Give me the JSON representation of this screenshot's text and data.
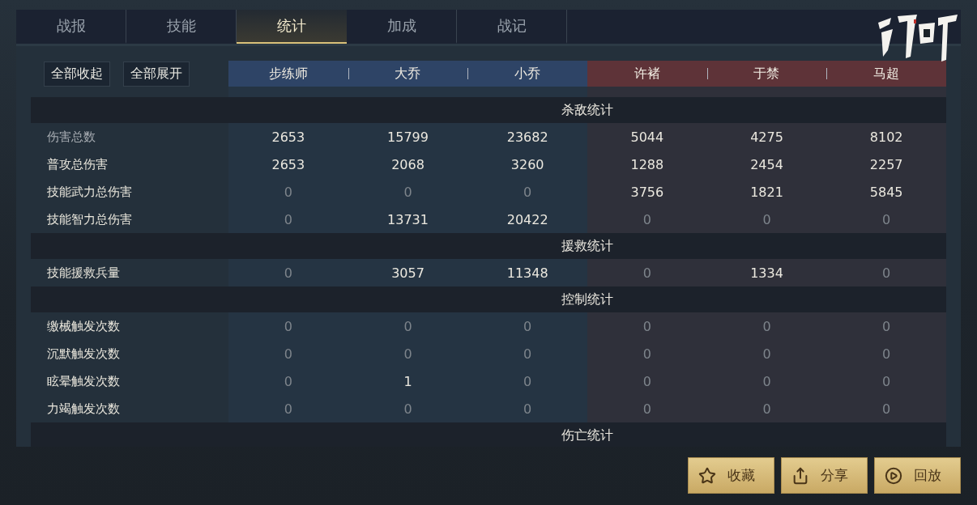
{
  "tabs": [
    {
      "label": "战报",
      "selected": false
    },
    {
      "label": "技能",
      "selected": false
    },
    {
      "label": "统计",
      "selected": true
    },
    {
      "label": "加成",
      "selected": false
    },
    {
      "label": "战记",
      "selected": false
    }
  ],
  "toolbar": {
    "collapse_all": "全部收起",
    "expand_all": "全部展开"
  },
  "heroes": [
    {
      "name": "步练师",
      "color": "#2e4466"
    },
    {
      "name": "大乔",
      "color": "#2e4466"
    },
    {
      "name": "小乔",
      "color": "#2e4466"
    },
    {
      "name": "许褚",
      "color": "#5e3338"
    },
    {
      "name": "于禁",
      "color": "#5e3338"
    },
    {
      "name": "马超",
      "color": "#5e3338"
    }
  ],
  "sections": [
    {
      "title": "杀敌统计",
      "rows": [
        {
          "label": "伤害总数",
          "dim": true,
          "cells": [
            {
              "text": "2653",
              "dim": false
            },
            {
              "text": "15799",
              "dim": false
            },
            {
              "text": "23682",
              "dim": false
            },
            {
              "text": "5044",
              "dim": false
            },
            {
              "text": "4275",
              "dim": false
            },
            {
              "text": "8102",
              "dim": false
            }
          ]
        },
        {
          "label": "普攻总伤害",
          "dim": false,
          "cells": [
            {
              "text": "2653",
              "dim": false
            },
            {
              "text": "2068",
              "dim": false
            },
            {
              "text": "3260",
              "dim": false
            },
            {
              "text": "1288",
              "dim": false
            },
            {
              "text": "2454",
              "dim": false
            },
            {
              "text": "2257",
              "dim": false
            }
          ]
        },
        {
          "label": "技能武力总伤害",
          "dim": false,
          "cells": [
            {
              "text": "0",
              "dim": true
            },
            {
              "text": "0",
              "dim": true
            },
            {
              "text": "0",
              "dim": true
            },
            {
              "text": "3756",
              "dim": false
            },
            {
              "text": "1821",
              "dim": false
            },
            {
              "text": "5845",
              "dim": false
            }
          ]
        },
        {
          "label": "技能智力总伤害",
          "dim": false,
          "cells": [
            {
              "text": "0",
              "dim": true
            },
            {
              "text": "13731",
              "dim": false
            },
            {
              "text": "20422",
              "dim": false
            },
            {
              "text": "0",
              "dim": true
            },
            {
              "text": "0",
              "dim": true
            },
            {
              "text": "0",
              "dim": true
            }
          ]
        }
      ]
    },
    {
      "title": "援救统计",
      "rows": [
        {
          "label": "技能援救兵量",
          "dim": false,
          "cells": [
            {
              "text": "0",
              "dim": true
            },
            {
              "text": "3057",
              "dim": false
            },
            {
              "text": "11348",
              "dim": false
            },
            {
              "text": "0",
              "dim": true
            },
            {
              "text": "1334",
              "dim": false
            },
            {
              "text": "0",
              "dim": true
            }
          ]
        }
      ]
    },
    {
      "title": "控制统计",
      "rows": [
        {
          "label": "缴械触发次数",
          "dim": false,
          "cells": [
            {
              "text": "0",
              "dim": true
            },
            {
              "text": "0",
              "dim": true
            },
            {
              "text": "0",
              "dim": true
            },
            {
              "text": "0",
              "dim": true
            },
            {
              "text": "0",
              "dim": true
            },
            {
              "text": "0",
              "dim": true
            }
          ]
        },
        {
          "label": "沉默触发次数",
          "dim": false,
          "cells": [
            {
              "text": "0",
              "dim": true
            },
            {
              "text": "0",
              "dim": true
            },
            {
              "text": "0",
              "dim": true
            },
            {
              "text": "0",
              "dim": true
            },
            {
              "text": "0",
              "dim": true
            },
            {
              "text": "0",
              "dim": true
            }
          ]
        },
        {
          "label": "眩晕触发次数",
          "dim": false,
          "cells": [
            {
              "text": "0",
              "dim": true
            },
            {
              "text": "1",
              "dim": false
            },
            {
              "text": "0",
              "dim": true
            },
            {
              "text": "0",
              "dim": true
            },
            {
              "text": "0",
              "dim": true
            },
            {
              "text": "0",
              "dim": true
            }
          ]
        },
        {
          "label": "力竭触发次数",
          "dim": false,
          "cells": [
            {
              "text": "0",
              "dim": true
            },
            {
              "text": "0",
              "dim": true
            },
            {
              "text": "0",
              "dim": true
            },
            {
              "text": "0",
              "dim": true
            },
            {
              "text": "0",
              "dim": true
            },
            {
              "text": "0",
              "dim": true
            }
          ]
        }
      ]
    },
    {
      "title": "伤亡统计"
    }
  ],
  "actions": [
    {
      "kind": "star",
      "label": "收藏"
    },
    {
      "kind": "share",
      "label": "分享"
    },
    {
      "kind": "play",
      "label": "回放"
    }
  ]
}
